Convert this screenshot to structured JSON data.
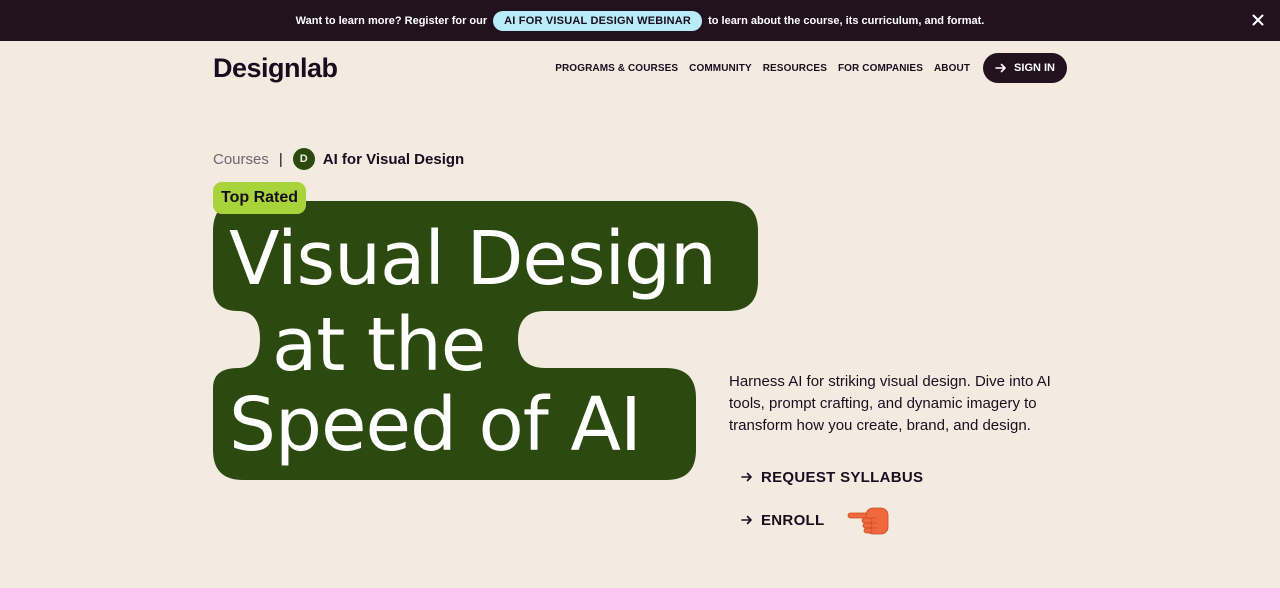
{
  "announcement": {
    "before": "Want to learn more? Register for our",
    "pill": "AI FOR VISUAL DESIGN WEBINAR",
    "after": "to learn about the course, its curriculum, and format.",
    "close_icon": "close-icon"
  },
  "header": {
    "logo": "Designlab",
    "nav": [
      "PROGRAMS & COURSES",
      "COMMUNITY",
      "RESOURCES",
      "FOR COMPANIES",
      "ABOUT"
    ],
    "signin": "SIGN IN",
    "signin_icon": "arrow-right-icon"
  },
  "breadcrumb": {
    "parent": "Courses",
    "separator": "|",
    "badge": "D",
    "current": "AI for Visual Design"
  },
  "hero": {
    "badge": "Top Rated",
    "lines": [
      "Visual Design",
      "at the",
      "Speed of AI"
    ]
  },
  "description": "Harness AI for striking visual design. Dive into AI tools, prompt crafting, and dynamic imagery to transform how you create, brand, and design.",
  "ctas": [
    {
      "label": "REQUEST SYLLABUS",
      "icon": "arrow-right-icon"
    },
    {
      "label": "ENROLL",
      "icon": "arrow-right-icon"
    }
  ],
  "decoration": {
    "hand_icon": "pointing-hand-icon"
  },
  "colors": {
    "background": "#f3ebe0",
    "dark": "#22111f",
    "hero_green": "#2c4a10",
    "badge_green": "#a9d33a",
    "webinar_pill": "#b8ecf8",
    "footer_pink": "#fcc6f3",
    "hand_orange": "#f0693c"
  }
}
